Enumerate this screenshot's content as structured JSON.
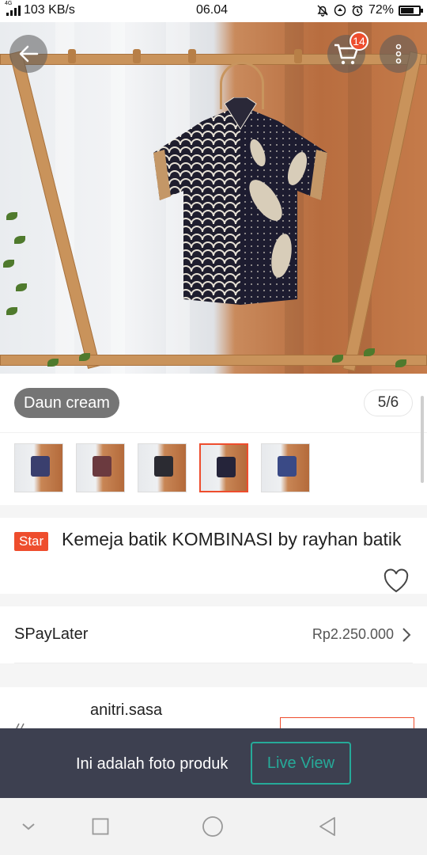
{
  "status_bar": {
    "network": "4G",
    "speed": "103 KB/s",
    "time": "06.04",
    "battery": "72%",
    "battery_level": 0.72,
    "icons": [
      "mute-bell-icon",
      "data-saver-icon",
      "alarm-icon"
    ]
  },
  "header": {
    "back_icon": "back-arrow-icon",
    "cart_icon": "cart-icon",
    "cart_count": "14",
    "more_icon": "more-vertical-icon"
  },
  "gallery": {
    "variant_label": "Daun cream",
    "page_counter": "5/6",
    "thumbnails": [
      {
        "label": "thumb-1",
        "shirt_color": "#3a3f6e",
        "active": false
      },
      {
        "label": "thumb-2",
        "shirt_color": "#6b3a3f",
        "active": false
      },
      {
        "label": "thumb-3",
        "shirt_color": "#2b2b32",
        "active": false
      },
      {
        "label": "thumb-4",
        "shirt_color": "#25243a",
        "active": true
      },
      {
        "label": "thumb-5",
        "shirt_color": "#3a4a86",
        "active": false
      }
    ]
  },
  "product": {
    "badge": "Star",
    "title": "Kemeja batik KOMBINASI by rayhan batik",
    "favorite_icon": "heart-outline-icon"
  },
  "spaylater": {
    "label": "SPayLater",
    "value": "Rp2.250.000",
    "chevron_icon": "chevron-right-icon"
  },
  "shop": {
    "name": "anitri.sasa"
  },
  "photo_bar": {
    "message": "Ini adalah foto produk",
    "live_view_label": "Live View"
  },
  "nav_bar": {
    "items": [
      "collapse-icon",
      "recents-icon",
      "home-icon",
      "back-icon"
    ]
  },
  "colors": {
    "accent": "#ee4d2d",
    "teal": "#26aa99",
    "photo_bar_bg": "#3d4050"
  }
}
